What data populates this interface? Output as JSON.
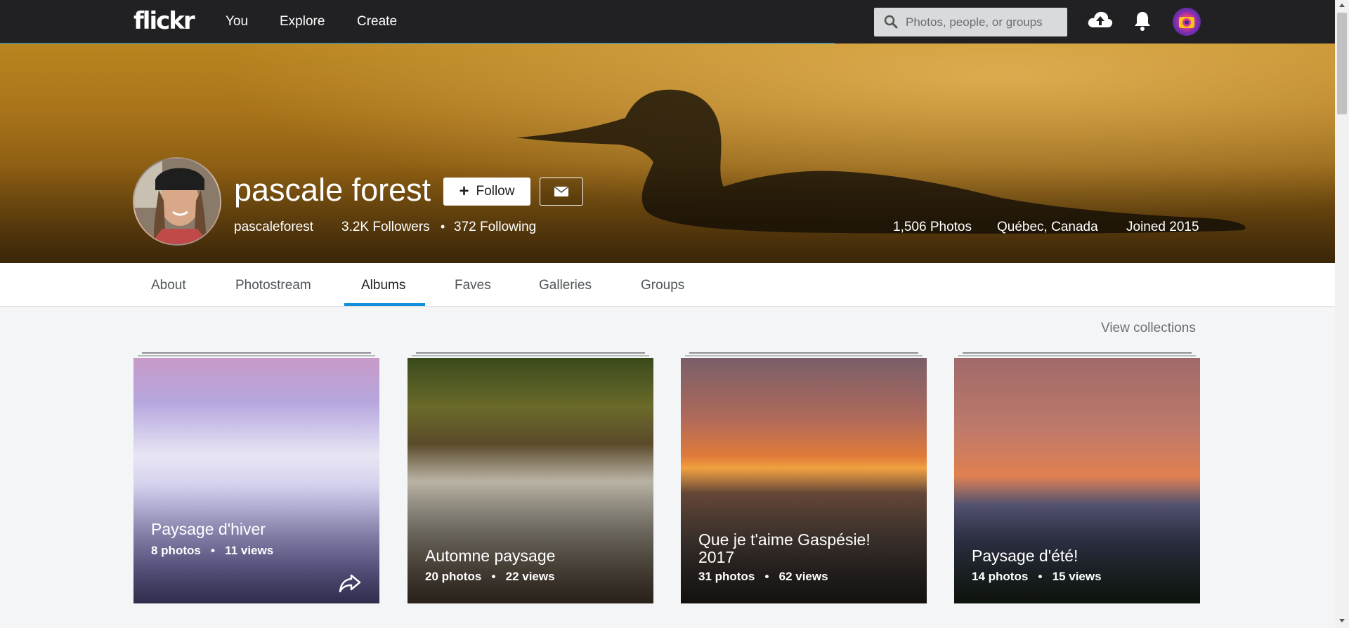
{
  "nav": {
    "logo": "flickr",
    "links": [
      "You",
      "Explore",
      "Create"
    ],
    "search_placeholder": "Photos, people, or groups",
    "icons": [
      "upload-cloud-icon",
      "notifications-bell-icon",
      "user-avatar"
    ]
  },
  "profile": {
    "name": "pascale forest",
    "username": "pascaleforest",
    "followers": "3.2K Followers",
    "following": "372 Following",
    "photos": "1,506 Photos",
    "location": "Québec, Canada",
    "joined": "Joined 2015",
    "follow_label": "Follow"
  },
  "tabs": [
    "About",
    "Photostream",
    "Albums",
    "Faves",
    "Galleries",
    "Groups"
  ],
  "active_tab": "Albums",
  "view_collections": "View collections",
  "albums": [
    {
      "title": "Paysage d'hiver",
      "photos": "8 photos",
      "views": "11 views"
    },
    {
      "title": "Automne paysage",
      "photos": "20 photos",
      "views": "22 views"
    },
    {
      "title": "Que je t'aime Gaspésie! 2017",
      "photos": "31 photos",
      "views": "62 views"
    },
    {
      "title": "Paysage d'été!",
      "photos": "14 photos",
      "views": "15 views"
    }
  ],
  "colors": {
    "nav_bg": "#212124",
    "accent_blue": "#128fdc",
    "page_bg": "#f3f5f6"
  }
}
